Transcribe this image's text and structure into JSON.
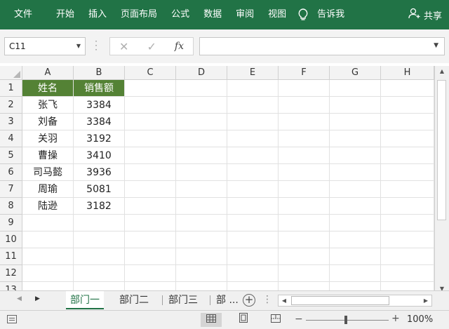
{
  "ribbon": {
    "tabs": [
      "文件",
      "开始",
      "插入",
      "页面布局",
      "公式",
      "数据",
      "审阅",
      "视图"
    ],
    "tell_me": "告诉我",
    "share": "共享",
    "icons": {
      "tell_me": "lightbulb-icon",
      "share": "person-add-icon"
    }
  },
  "formula_bar": {
    "name_box": "C11",
    "fx_label": "fx",
    "formula": ""
  },
  "grid": {
    "columns": [
      "A",
      "B",
      "C",
      "D",
      "E",
      "F",
      "G",
      "H"
    ],
    "rows": [
      "1",
      "2",
      "3",
      "4",
      "5",
      "6",
      "7",
      "8",
      "9",
      "10",
      "11",
      "12",
      "13"
    ],
    "cells": [
      [
        "姓名",
        "销售额"
      ],
      [
        "张飞",
        "3384"
      ],
      [
        "刘备",
        "3384"
      ],
      [
        "关羽",
        "3192"
      ],
      [
        "曹操",
        "3410"
      ],
      [
        "司马懿",
        "3936"
      ],
      [
        "周瑜",
        "5081"
      ],
      [
        "陆逊",
        "3182"
      ]
    ],
    "header_color": "#548235"
  },
  "sheets": {
    "tabs": [
      "部门一",
      "部门二",
      "部门三",
      "部 ..."
    ],
    "active": "部门一"
  },
  "status": {
    "zoom": "100%"
  },
  "colors": {
    "accent": "#217346",
    "header_fill": "#548235"
  }
}
